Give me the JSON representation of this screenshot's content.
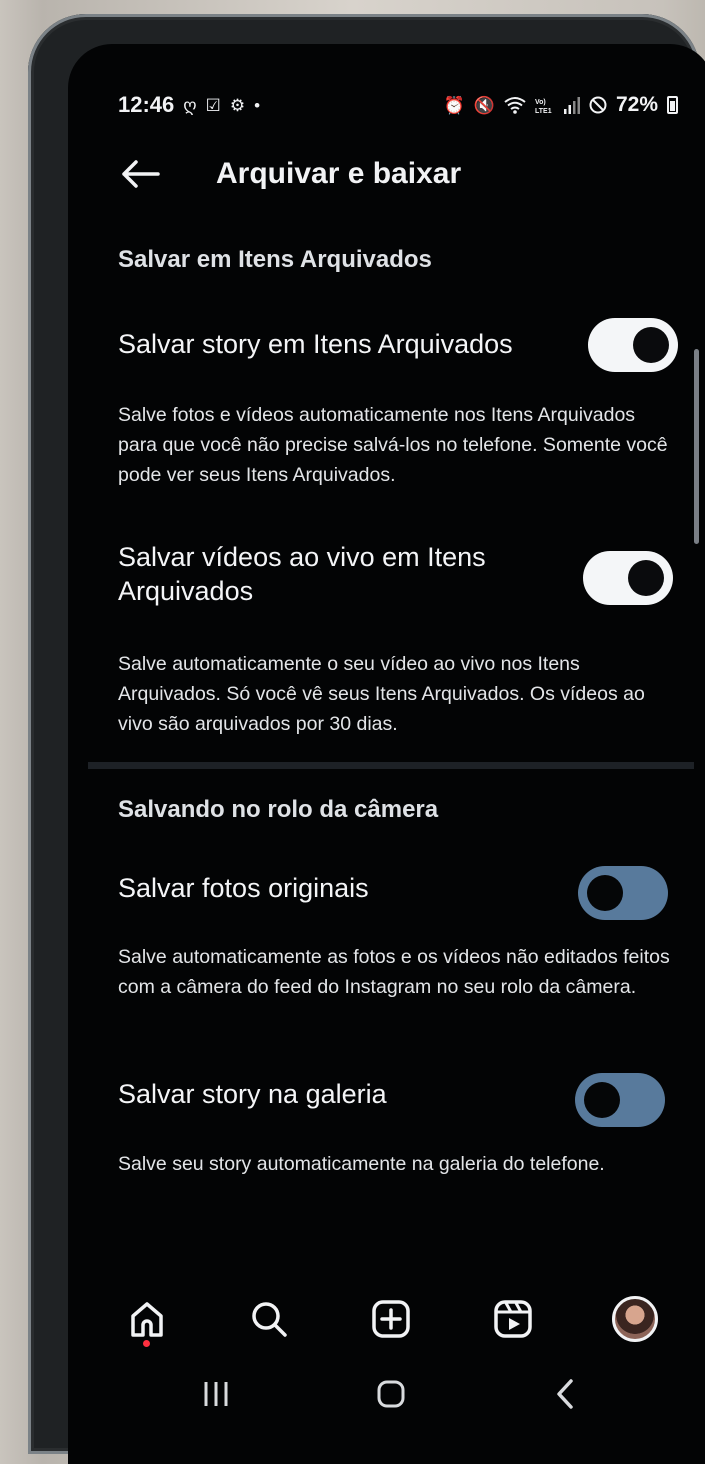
{
  "status_bar": {
    "time": "12:46",
    "battery": "72%"
  },
  "header": {
    "title": "Arquivar e baixar"
  },
  "archive_section": {
    "title": "Salvar em Itens Arquivados",
    "items": [
      {
        "label": "Salvar story em Itens Arquivados",
        "enabled": true,
        "description": "Salve fotos e vídeos automaticamente nos Itens Arquivados para que você não precise salvá-los no telefone. Somente você pode ver seus Itens Arquivados."
      },
      {
        "label": "Salvar vídeos ao vivo em Itens Arquivados",
        "enabled": true,
        "description": "Salve automaticamente o seu vídeo ao vivo nos Itens Arquivados. Só você vê seus Itens Arquivados. Os vídeos ao vivo são arquivados por 30 dias."
      }
    ]
  },
  "camera_section": {
    "title": "Salvando no rolo da câmera",
    "items": [
      {
        "label": "Salvar fotos originais",
        "enabled": false,
        "description": "Salve automaticamente as fotos e os vídeos não editados feitos com a câmera do feed do Instagram no seu rolo da câmera."
      },
      {
        "label": "Salvar story na galeria",
        "enabled": false,
        "description": "Salve seu story automaticamente na galeria do telefone."
      }
    ]
  },
  "bottom_nav": [
    "home-icon",
    "search-icon",
    "create-icon",
    "reels-icon",
    "profile-avatar"
  ],
  "system_nav": [
    "recents-icon",
    "home-circle-icon",
    "back-chevron-icon"
  ],
  "colors": {
    "background": "#030405",
    "toggle_on": "#f4f6f8",
    "toggle_off": "#587a9c",
    "notification_dot": "#ff3040"
  }
}
